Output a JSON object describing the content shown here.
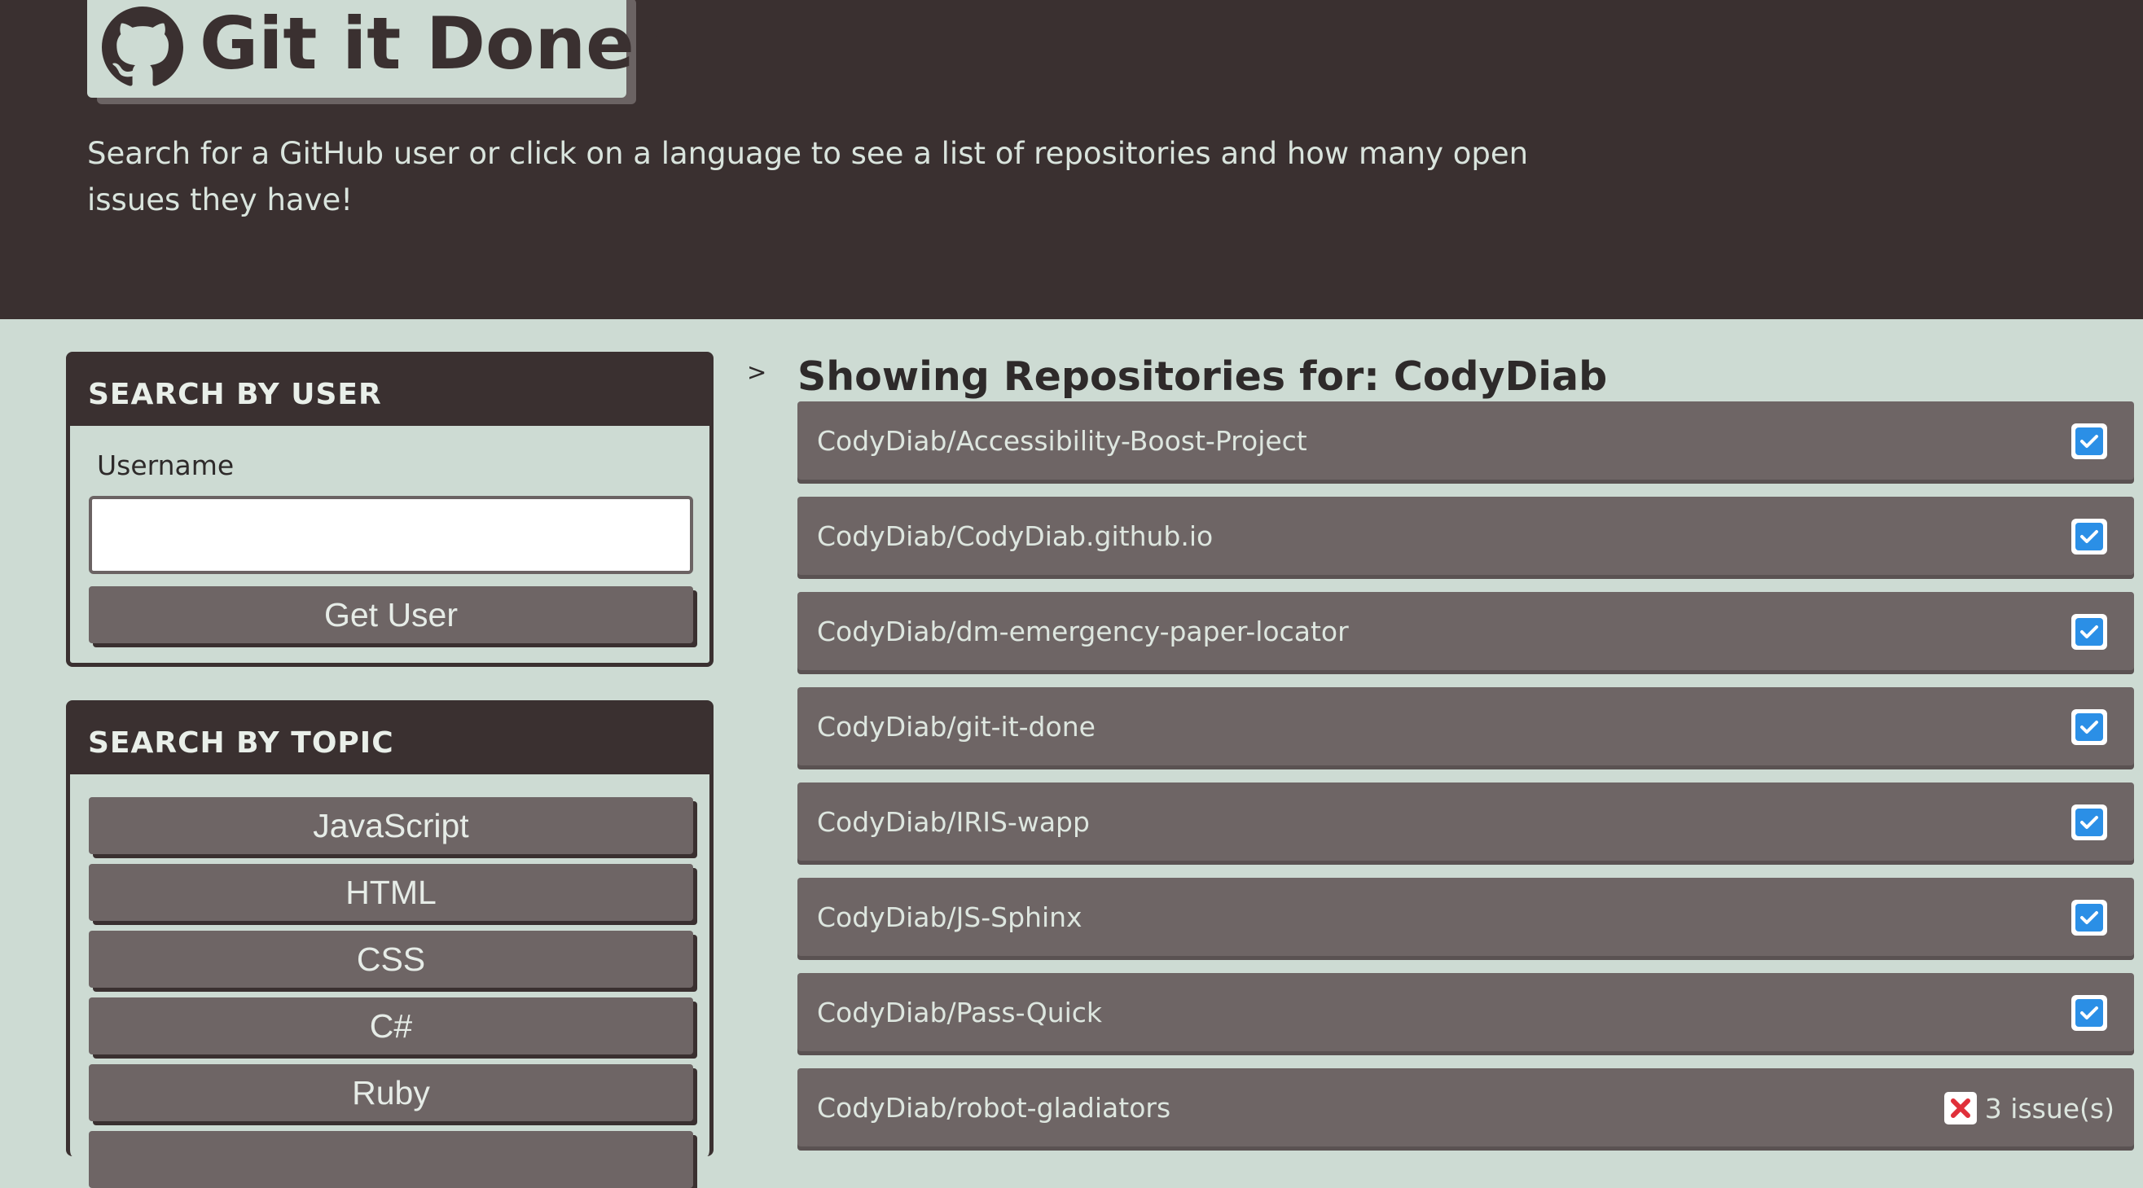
{
  "header": {
    "title": "Git it Done!",
    "subtitle": "Search for a GitHub user or click on a language to see a list of repositories and how many open issues they have!"
  },
  "user_search": {
    "heading": "SEARCH BY USER",
    "field_label": "Username",
    "input_value": "",
    "button_label": "Get User"
  },
  "topic_search": {
    "heading": "SEARCH BY TOPIC",
    "languages": [
      "JavaScript",
      "HTML",
      "CSS",
      "C#",
      "Ruby"
    ]
  },
  "results": {
    "toggle_glyph": ">",
    "title": "Showing Repositories for: CodyDiab",
    "repos": [
      {
        "name": "CodyDiab/Accessibility-Boost-Project",
        "status": "no-issues"
      },
      {
        "name": "CodyDiab/CodyDiab.github.io",
        "status": "no-issues"
      },
      {
        "name": "CodyDiab/dm-emergency-paper-locator",
        "status": "no-issues"
      },
      {
        "name": "CodyDiab/git-it-done",
        "status": "no-issues"
      },
      {
        "name": "CodyDiab/IRIS-wapp",
        "status": "no-issues"
      },
      {
        "name": "CodyDiab/JS-Sphinx",
        "status": "no-issues"
      },
      {
        "name": "CodyDiab/Pass-Quick",
        "status": "no-issues"
      },
      {
        "name": "CodyDiab/robot-gladiators",
        "status": "issues",
        "issues_text": "3 issue(s)"
      }
    ]
  },
  "icons": {
    "logo": "github-octocat-icon",
    "check": "check-square-icon",
    "error": "x-square-icon"
  },
  "colors": {
    "header_bg": "#3a3030",
    "page_bg": "#cddbd3",
    "button_bg": "#6e6565",
    "check_blue": "#2b8fe6",
    "error_red": "#e0303a"
  }
}
